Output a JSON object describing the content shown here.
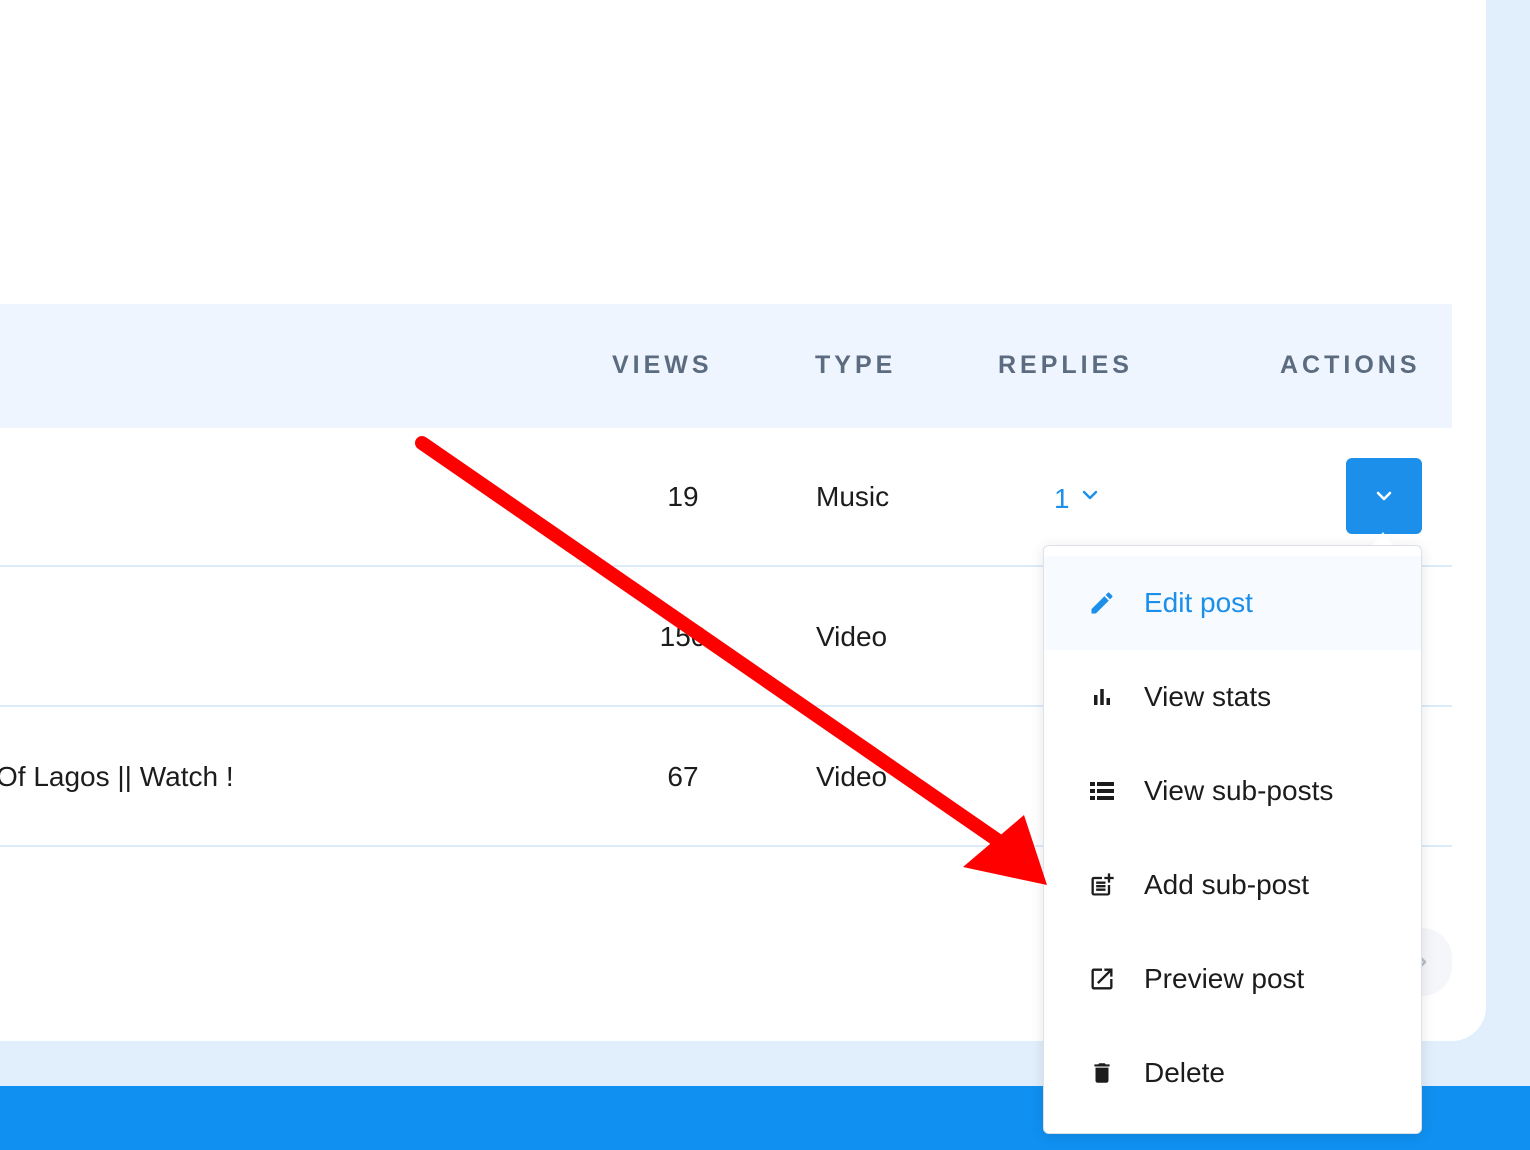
{
  "table": {
    "headers": {
      "views": "VIEWS",
      "type": "TYPE",
      "replies": "REPLIES",
      "actions": "ACTIONS"
    },
    "rows": [
      {
        "title": "",
        "views": "19",
        "type": "Music",
        "replies": "1"
      },
      {
        "title": "",
        "views": "150",
        "type": "Video"
      },
      {
        "title": "Of Lagos || Watch !",
        "views": "67",
        "type": "Video"
      }
    ]
  },
  "actions_menu": {
    "items": [
      {
        "label": "Edit post",
        "icon": "pencil-icon"
      },
      {
        "label": "View stats",
        "icon": "bar-chart-icon"
      },
      {
        "label": "View sub-posts",
        "icon": "list-icon"
      },
      {
        "label": "Add sub-post",
        "icon": "post-add-icon"
      },
      {
        "label": "Preview post",
        "icon": "open-in-new-icon"
      },
      {
        "label": "Delete",
        "icon": "trash-icon"
      }
    ]
  },
  "colors": {
    "accent": "#1b8fe9",
    "footer": "#1090f1",
    "header_bg": "#eff5fe",
    "page_bg": "#e1eefc",
    "annotation_arrow": "#ff0000"
  }
}
